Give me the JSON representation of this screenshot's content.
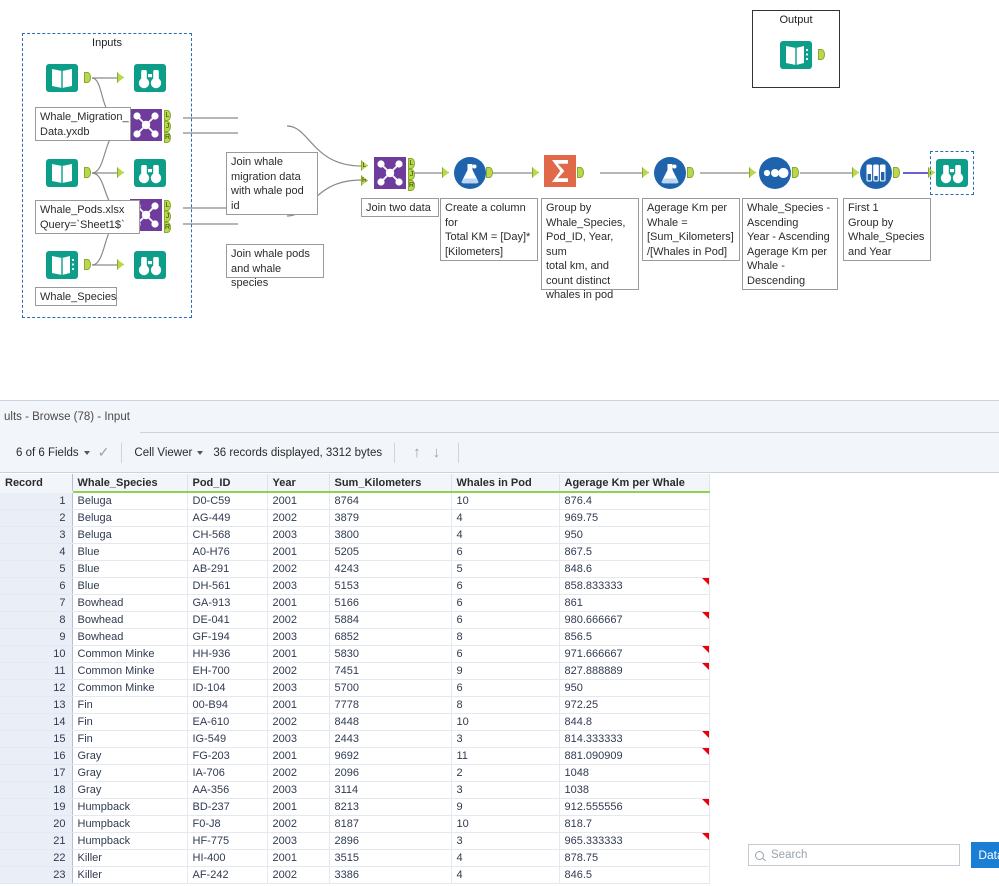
{
  "canvas": {
    "containers": [
      {
        "name": "inputs-container",
        "label": "Inputs"
      },
      {
        "name": "output-container",
        "label": "Output"
      }
    ],
    "tools": [
      {
        "name": "input-tool-whale-migration",
        "type": "input-data-icon"
      },
      {
        "name": "browse-tool-whale-migration",
        "type": "browse-icon"
      },
      {
        "name": "input-tool-whale-pods",
        "type": "input-data-icon"
      },
      {
        "name": "browse-tool-whale-pods",
        "type": "browse-icon"
      },
      {
        "name": "input-tool-whale-species",
        "type": "input-data-icon"
      },
      {
        "name": "browse-tool-whale-species",
        "type": "browse-icon"
      },
      {
        "name": "join-tool-migration-pods",
        "type": "join-icon"
      },
      {
        "name": "join-tool-pods-species",
        "type": "join-icon"
      },
      {
        "name": "join-tool-two-data",
        "type": "join-icon"
      },
      {
        "name": "formula-tool-total-km",
        "type": "formula-icon"
      },
      {
        "name": "summarize-tool",
        "type": "summarize-icon"
      },
      {
        "name": "formula-tool-average-km",
        "type": "formula-icon"
      },
      {
        "name": "sort-tool",
        "type": "sort-icon"
      },
      {
        "name": "sample-tool",
        "type": "sample-icon"
      },
      {
        "name": "browse-tool-final",
        "type": "browse-icon"
      },
      {
        "name": "output-tool",
        "type": "output-data-icon"
      }
    ],
    "annotations": {
      "whale_migration": "Whale_Migration_\nData.yxdb",
      "whale_pods": "Whale_Pods.xlsx\nQuery=`Sheet1$`",
      "whale_species": "Whale_Species",
      "join_migration_pods": "Join whale\nmigration data\nwith  whale pod\nid",
      "join_pods_species": "Join whale pods\nand whale species",
      "join_two_data": "Join two data",
      "formula_total_km": "Create a column\nfor\nTotal KM = [Day]*\n[Kilometers]",
      "summarize": "Group by\nWhale_Species,\nPod_ID, Year, sum\ntotal km, and\ncount distinct\nwhales in pod",
      "formula_avg": "Agerage Km per\nWhale =\n[Sum_Kilometers]\n/[Whales in Pod]",
      "sort": "Whale_Species -\nAscending\nYear - Ascending\nAgerage Km per\nWhale -\nDescending",
      "sample": "First 1\nGroup by\nWhale_Species\nand Year"
    },
    "colors": {
      "teal": "#0d9e8a",
      "purple": "#6f3c9e",
      "blue": "#1f63ac",
      "orange": "#e2684a",
      "anchor_green": "#b9d94a",
      "selection_blue": "#2a6ebb"
    }
  },
  "results": {
    "tab_title": "ults - Browse (78) - Input",
    "toolbar": {
      "fields_label": "6 of 6 Fields",
      "check_icon": "checkmark",
      "viewer_label": "Cell Viewer",
      "records_label": "36 records displayed, 3312 bytes",
      "up_arrow": "↑",
      "down_arrow": "↓"
    },
    "search": {
      "placeholder": "Search",
      "value": ""
    },
    "data_button": "Data",
    "table": {
      "columns": [
        "Record",
        "Whale_Species",
        "Pod_ID",
        "Year",
        "Sum_Kilometers",
        "Whales in Pod",
        "Agerage Km per Whale"
      ],
      "rows": [
        {
          "record": "1",
          "species": "Beluga",
          "pod": "D0-C59",
          "year": "2001",
          "sum": "8764",
          "whales": "10",
          "avg": "876.4",
          "flag": false
        },
        {
          "record": "2",
          "species": "Beluga",
          "pod": "AG-449",
          "year": "2002",
          "sum": "3879",
          "whales": "4",
          "avg": "969.75",
          "flag": false
        },
        {
          "record": "3",
          "species": "Beluga",
          "pod": "CH-568",
          "year": "2003",
          "sum": "3800",
          "whales": "4",
          "avg": "950",
          "flag": false
        },
        {
          "record": "4",
          "species": "Blue",
          "pod": "A0-H76",
          "year": "2001",
          "sum": "5205",
          "whales": "6",
          "avg": "867.5",
          "flag": false
        },
        {
          "record": "5",
          "species": "Blue",
          "pod": "AB-291",
          "year": "2002",
          "sum": "4243",
          "whales": "5",
          "avg": "848.6",
          "flag": false
        },
        {
          "record": "6",
          "species": "Blue",
          "pod": "DH-561",
          "year": "2003",
          "sum": "5153",
          "whales": "6",
          "avg": "858.833333",
          "flag": true
        },
        {
          "record": "7",
          "species": "Bowhead",
          "pod": "GA-913",
          "year": "2001",
          "sum": "5166",
          "whales": "6",
          "avg": "861",
          "flag": false
        },
        {
          "record": "8",
          "species": "Bowhead",
          "pod": "DE-041",
          "year": "2002",
          "sum": "5884",
          "whales": "6",
          "avg": "980.666667",
          "flag": true
        },
        {
          "record": "9",
          "species": "Bowhead",
          "pod": "GF-194",
          "year": "2003",
          "sum": "6852",
          "whales": "8",
          "avg": "856.5",
          "flag": false
        },
        {
          "record": "10",
          "species": "Common Minke",
          "pod": "HH-936",
          "year": "2001",
          "sum": "5830",
          "whales": "6",
          "avg": "971.666667",
          "flag": true
        },
        {
          "record": "11",
          "species": "Common Minke",
          "pod": "EH-700",
          "year": "2002",
          "sum": "7451",
          "whales": "9",
          "avg": "827.888889",
          "flag": true
        },
        {
          "record": "12",
          "species": "Common Minke",
          "pod": "ID-104",
          "year": "2003",
          "sum": "5700",
          "whales": "6",
          "avg": "950",
          "flag": false
        },
        {
          "record": "13",
          "species": "Fin",
          "pod": "00-B94",
          "year": "2001",
          "sum": "7778",
          "whales": "8",
          "avg": "972.25",
          "flag": false
        },
        {
          "record": "14",
          "species": "Fin",
          "pod": "EA-610",
          "year": "2002",
          "sum": "8448",
          "whales": "10",
          "avg": "844.8",
          "flag": false
        },
        {
          "record": "15",
          "species": "Fin",
          "pod": "IG-549",
          "year": "2003",
          "sum": "2443",
          "whales": "3",
          "avg": "814.333333",
          "flag": true
        },
        {
          "record": "16",
          "species": "Gray",
          "pod": "FG-203",
          "year": "2001",
          "sum": "9692",
          "whales": "11",
          "avg": "881.090909",
          "flag": true
        },
        {
          "record": "17",
          "species": "Gray",
          "pod": "IA-706",
          "year": "2002",
          "sum": "2096",
          "whales": "2",
          "avg": "1048",
          "flag": false
        },
        {
          "record": "18",
          "species": "Gray",
          "pod": "AA-356",
          "year": "2003",
          "sum": "3114",
          "whales": "3",
          "avg": "1038",
          "flag": false
        },
        {
          "record": "19",
          "species": "Humpback",
          "pod": "BD-237",
          "year": "2001",
          "sum": "8213",
          "whales": "9",
          "avg": "912.555556",
          "flag": true
        },
        {
          "record": "20",
          "species": "Humpback",
          "pod": "F0-J8",
          "year": "2002",
          "sum": "8187",
          "whales": "10",
          "avg": "818.7",
          "flag": false
        },
        {
          "record": "21",
          "species": "Humpback",
          "pod": "HF-775",
          "year": "2003",
          "sum": "2896",
          "whales": "3",
          "avg": "965.333333",
          "flag": true
        },
        {
          "record": "22",
          "species": "Killer",
          "pod": "HI-400",
          "year": "2001",
          "sum": "3515",
          "whales": "4",
          "avg": "878.75",
          "flag": false
        },
        {
          "record": "23",
          "species": "Killer",
          "pod": "AF-242",
          "year": "2002",
          "sum": "3386",
          "whales": "4",
          "avg": "846.5",
          "flag": false
        }
      ]
    }
  }
}
